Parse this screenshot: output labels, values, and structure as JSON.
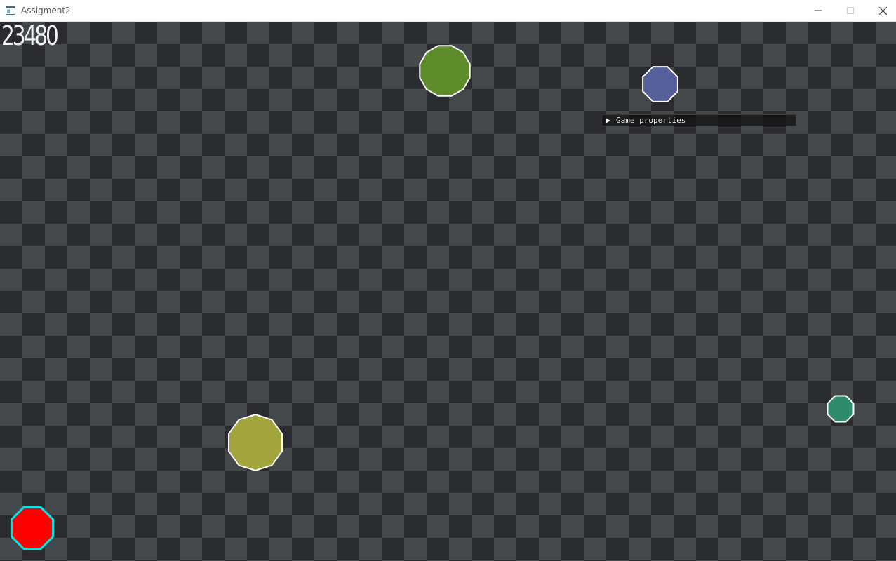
{
  "window": {
    "title": "Assigment2",
    "icons": [
      "app-icon",
      "minimize-icon",
      "maximize-icon",
      "close-icon"
    ]
  },
  "hud": {
    "score": "23480"
  },
  "panel": {
    "label": "Game properties",
    "state": "collapsed",
    "icon": "triangle-right-icon"
  },
  "colors": {
    "board_dark": "#2a2b2e",
    "board_light": "#45484b",
    "player_fill": "#ff0000",
    "player_outline": "#00e5e5",
    "enemy_outline": "#ffffff"
  },
  "entities": [
    {
      "name": "player-polygon",
      "role": "player",
      "sides": 8,
      "fill": "#ff0000",
      "outline": "#00e5e5"
    },
    {
      "name": "enemy-green",
      "role": "enemy",
      "sides": 12,
      "fill": "#5e8c2a",
      "outline": "#ffffff"
    },
    {
      "name": "enemy-blue",
      "role": "enemy",
      "sides": 8,
      "fill": "#55609b",
      "outline": "#ffffff"
    },
    {
      "name": "enemy-olive",
      "role": "enemy",
      "sides": 10,
      "fill": "#a2a43c",
      "outline": "#ffffff"
    },
    {
      "name": "enemy-teal",
      "role": "enemy",
      "sides": 8,
      "fill": "#2e8b6c",
      "outline": "#ffffff"
    }
  ]
}
